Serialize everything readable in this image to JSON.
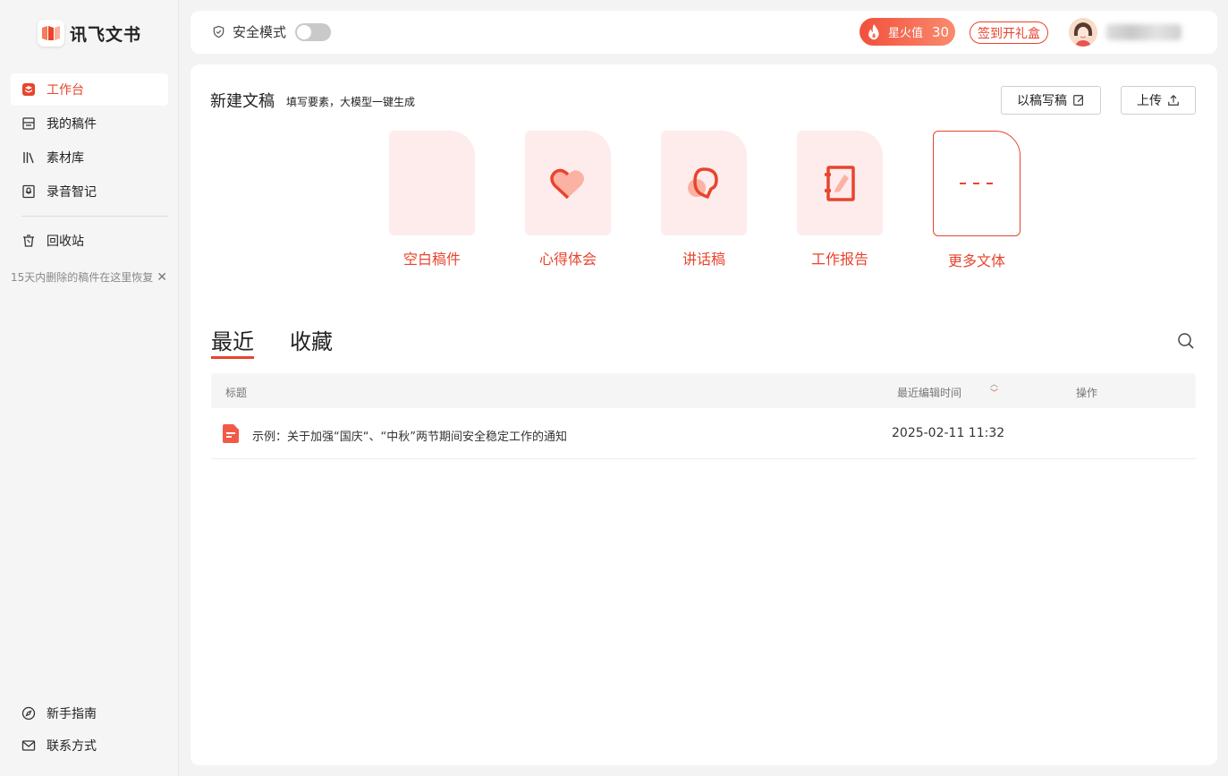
{
  "app": {
    "logo_text": "讯飞文书"
  },
  "sidebar": {
    "items": [
      {
        "label": "工作台",
        "icon": "workbench-icon",
        "active": true
      },
      {
        "label": "我的稿件",
        "icon": "drafts-icon"
      },
      {
        "label": "素材库",
        "icon": "library-icon"
      },
      {
        "label": "录音智记",
        "icon": "recorder-icon"
      },
      {
        "label": "回收站",
        "icon": "trash-icon"
      }
    ],
    "recycle_hint": "15天内删除的稿件在这里恢复",
    "bottom": [
      {
        "label": "新手指南",
        "icon": "compass-icon"
      },
      {
        "label": "联系方式",
        "icon": "mail-icon"
      }
    ]
  },
  "topbar": {
    "safe_mode_label": "安全模式",
    "safe_mode_on": false,
    "fire_label": "星火值",
    "fire_value": "30",
    "gift_button": "签到开礼盒"
  },
  "new_doc": {
    "title": "新建文稿",
    "subtitle": "填写要素，大模型一键生成",
    "write_button": "以稿写稿",
    "upload_button": "上传",
    "templates": [
      {
        "label": "空白稿件",
        "icon": "blank-doc-icon"
      },
      {
        "label": "心得体会",
        "icon": "heart-icon"
      },
      {
        "label": "讲话稿",
        "icon": "speech-icon"
      },
      {
        "label": "工作报告",
        "icon": "report-icon"
      },
      {
        "label": "更多文体",
        "icon": "more-dashes-icon"
      }
    ]
  },
  "docs": {
    "tabs": [
      {
        "label": "最近",
        "active": true
      },
      {
        "label": "收藏"
      }
    ],
    "columns": {
      "title": "标题",
      "edited": "最近编辑时间",
      "actions": "操作"
    },
    "rows": [
      {
        "title": "示例：关于加强“国庆“、“中秋”两节期间安全稳定工作的通知",
        "edited": "2025-02-11 11:32"
      }
    ]
  },
  "colors": {
    "accent": "#e8442e",
    "card_bg": "#fdeceb"
  }
}
